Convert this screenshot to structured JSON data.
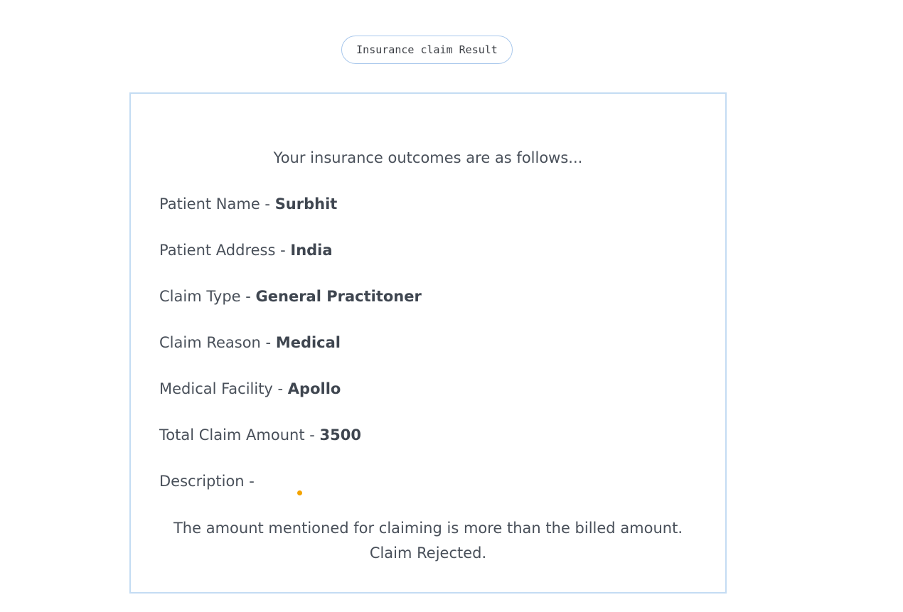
{
  "header": {
    "title": "Insurance claim Result"
  },
  "result": {
    "intro": "Your insurance outcomes are as follows...",
    "separator": " - ",
    "fields": [
      {
        "label": "Patient Name",
        "value": "Surbhit"
      },
      {
        "label": "Patient Address",
        "value": "India"
      },
      {
        "label": "Claim Type",
        "value": "General Practitoner"
      },
      {
        "label": "Claim Reason",
        "value": "Medical"
      },
      {
        "label": "Medical Facility",
        "value": "Apollo"
      },
      {
        "label": "Total Claim Amount",
        "value": "3500"
      }
    ],
    "description_label": "Description -",
    "description": "The amount mentioned for claiming is more than the billed amount. Claim Rejected."
  },
  "colors": {
    "pill_border": "#a9c8ec",
    "card_border": "#c4dcf3",
    "text": "#49505a",
    "cursor_dot": "#f4a300"
  }
}
